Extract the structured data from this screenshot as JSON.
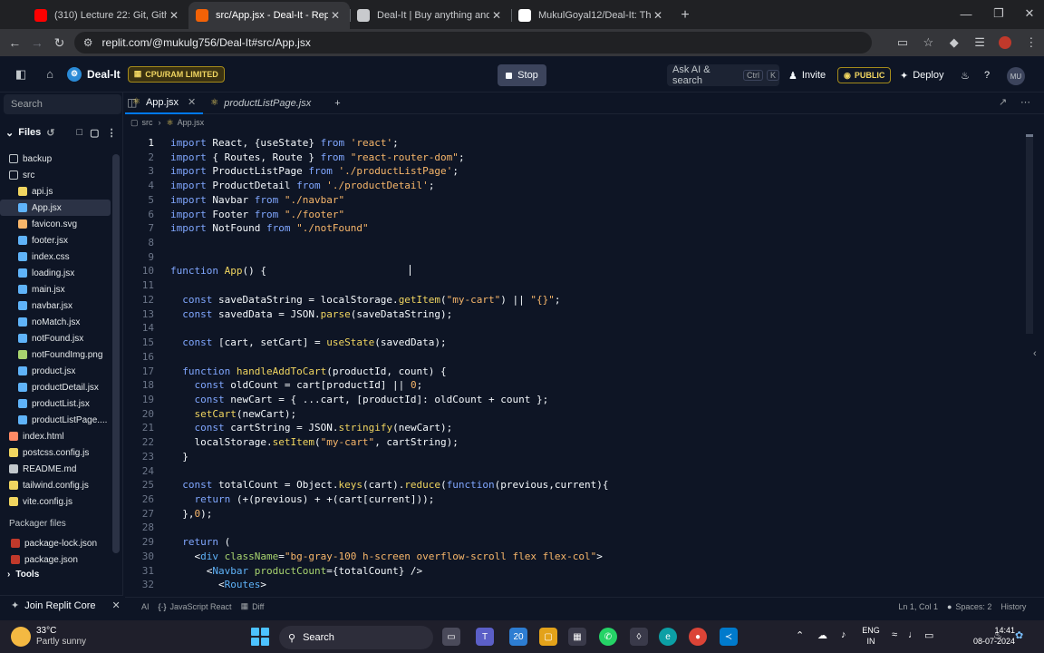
{
  "browser": {
    "tabs": [
      {
        "title": "(310) Lecture 22: Git, Github &",
        "icon": "youtube-icon",
        "color": "#ff0000"
      },
      {
        "title": "src/App.jsx - Deal-It - Replit",
        "icon": "replit-icon",
        "color": "#f26207",
        "active": true
      },
      {
        "title": "Deal-It | Buy anything and get",
        "icon": "globe-icon",
        "color": "#c8cacd"
      },
      {
        "title": "MukulGoyal12/Deal-It: This is a",
        "icon": "github-icon",
        "color": "#ffffff"
      }
    ],
    "url": "replit.com/@mukulg756/Deal-It#src/App.jsx"
  },
  "header": {
    "project": "Deal-It",
    "cpu_badge": "CPU/RAM LIMITED",
    "stop_label": "Stop",
    "ask_ai": "Ask AI & search",
    "ask_kbd_1": "Ctrl",
    "ask_kbd_2": "K",
    "invite": "Invite",
    "public_badge": "PUBLIC",
    "deploy": "Deploy",
    "avatar": "MU"
  },
  "sidebar": {
    "search_placeholder": "Search",
    "files_label": "Files",
    "items": [
      {
        "name": "backup",
        "type": "folder",
        "indent": 0
      },
      {
        "name": "src",
        "type": "folder",
        "indent": 0
      },
      {
        "name": "api.js",
        "type": "js",
        "indent": 1
      },
      {
        "name": "App.jsx",
        "type": "jsx",
        "indent": 1,
        "selected": true
      },
      {
        "name": "favicon.svg",
        "type": "svg",
        "indent": 1
      },
      {
        "name": "footer.jsx",
        "type": "jsx",
        "indent": 1
      },
      {
        "name": "index.css",
        "type": "css",
        "indent": 1
      },
      {
        "name": "loading.jsx",
        "type": "jsx",
        "indent": 1
      },
      {
        "name": "main.jsx",
        "type": "jsx",
        "indent": 1
      },
      {
        "name": "navbar.jsx",
        "type": "jsx",
        "indent": 1
      },
      {
        "name": "noMatch.jsx",
        "type": "jsx",
        "indent": 1
      },
      {
        "name": "notFound.jsx",
        "type": "jsx",
        "indent": 1
      },
      {
        "name": "notFoundImg.png",
        "type": "img",
        "indent": 1
      },
      {
        "name": "product.jsx",
        "type": "jsx",
        "indent": 1
      },
      {
        "name": "productDetail.jsx",
        "type": "jsx",
        "indent": 1
      },
      {
        "name": "productList.jsx",
        "type": "jsx",
        "indent": 1
      },
      {
        "name": "productListPage....",
        "type": "jsx",
        "indent": 1
      },
      {
        "name": "index.html",
        "type": "html",
        "indent": 0
      },
      {
        "name": "postcss.config.js",
        "type": "js",
        "indent": 0
      },
      {
        "name": "README.md",
        "type": "md",
        "indent": 0
      },
      {
        "name": "tailwind.config.js",
        "type": "js",
        "indent": 0
      },
      {
        "name": "vite.config.js",
        "type": "js",
        "indent": 0
      }
    ],
    "packager_label": "Packager files",
    "packager_items": [
      {
        "name": "package-lock.json"
      },
      {
        "name": "package.json"
      }
    ],
    "tools_label": "Tools",
    "join_label": "Join Replit Core"
  },
  "editor": {
    "tabs": [
      {
        "label": "App.jsx",
        "active": true
      },
      {
        "label": "productListPage.jsx",
        "active": false
      }
    ],
    "breadcrumb": [
      "src",
      "App.jsx"
    ],
    "lines": [
      [
        [
          "kw",
          "import"
        ],
        [
          "pl",
          " React, {useState} "
        ],
        [
          "kw",
          "from"
        ],
        [
          "pl",
          " "
        ],
        [
          "st",
          "'react'"
        ],
        [
          "pl",
          ";"
        ]
      ],
      [
        [
          "kw",
          "import"
        ],
        [
          "pl",
          " { Routes, Route } "
        ],
        [
          "kw",
          "from"
        ],
        [
          "pl",
          " "
        ],
        [
          "st",
          "\"react-router-dom\""
        ],
        [
          "pl",
          ";"
        ]
      ],
      [
        [
          "kw",
          "import"
        ],
        [
          "pl",
          " ProductListPage "
        ],
        [
          "kw",
          "from"
        ],
        [
          "pl",
          " "
        ],
        [
          "st",
          "'./productListPage'"
        ],
        [
          "pl",
          ";"
        ]
      ],
      [
        [
          "kw",
          "import"
        ],
        [
          "pl",
          " ProductDetail "
        ],
        [
          "kw",
          "from"
        ],
        [
          "pl",
          " "
        ],
        [
          "st",
          "'./productDetail'"
        ],
        [
          "pl",
          ";"
        ]
      ],
      [
        [
          "kw",
          "import"
        ],
        [
          "pl",
          " Navbar "
        ],
        [
          "kw",
          "from"
        ],
        [
          "pl",
          " "
        ],
        [
          "st",
          "\"./navbar\""
        ]
      ],
      [
        [
          "kw",
          "import"
        ],
        [
          "pl",
          " Footer "
        ],
        [
          "kw",
          "from"
        ],
        [
          "pl",
          " "
        ],
        [
          "st",
          "\"./footer\""
        ]
      ],
      [
        [
          "kw",
          "import"
        ],
        [
          "pl",
          " NotFound "
        ],
        [
          "kw",
          "from"
        ],
        [
          "pl",
          " "
        ],
        [
          "st",
          "\"./notFound\""
        ]
      ],
      [],
      [],
      [
        [
          "kw",
          "function"
        ],
        [
          "pl",
          " "
        ],
        [
          "fn",
          "App"
        ],
        [
          "pl",
          "() {"
        ]
      ],
      [],
      [
        [
          "pl",
          "  "
        ],
        [
          "kw",
          "const"
        ],
        [
          "pl",
          " saveDataString = localStorage."
        ],
        [
          "fn",
          "getItem"
        ],
        [
          "pl",
          "("
        ],
        [
          "st",
          "\"my-cart\""
        ],
        [
          "pl",
          ") || "
        ],
        [
          "st",
          "\"{}\""
        ],
        [
          "pl",
          ";"
        ]
      ],
      [
        [
          "pl",
          "  "
        ],
        [
          "kw",
          "const"
        ],
        [
          "pl",
          " savedData = JSON."
        ],
        [
          "fn",
          "parse"
        ],
        [
          "pl",
          "(saveDataString);"
        ]
      ],
      [],
      [
        [
          "pl",
          "  "
        ],
        [
          "kw",
          "const"
        ],
        [
          "pl",
          " [cart, setCart] = "
        ],
        [
          "fn",
          "useState"
        ],
        [
          "pl",
          "(savedData);"
        ]
      ],
      [],
      [
        [
          "pl",
          "  "
        ],
        [
          "kw",
          "function"
        ],
        [
          "pl",
          " "
        ],
        [
          "fn",
          "handleAddToCart"
        ],
        [
          "pl",
          "(productId, count) {"
        ]
      ],
      [
        [
          "pl",
          "    "
        ],
        [
          "kw",
          "const"
        ],
        [
          "pl",
          " oldCount = cart[productId] || "
        ],
        [
          "st",
          "0"
        ],
        [
          "pl",
          ";"
        ]
      ],
      [
        [
          "pl",
          "    "
        ],
        [
          "kw",
          "const"
        ],
        [
          "pl",
          " newCart = { ...cart, [productId]: oldCount + count };"
        ]
      ],
      [
        [
          "pl",
          "    "
        ],
        [
          "fn",
          "setCart"
        ],
        [
          "pl",
          "(newCart);"
        ]
      ],
      [
        [
          "pl",
          "    "
        ],
        [
          "kw",
          "const"
        ],
        [
          "pl",
          " cartString = JSON."
        ],
        [
          "fn",
          "stringify"
        ],
        [
          "pl",
          "(newCart);"
        ]
      ],
      [
        [
          "pl",
          "    localStorage."
        ],
        [
          "fn",
          "setItem"
        ],
        [
          "pl",
          "("
        ],
        [
          "st",
          "\"my-cart\""
        ],
        [
          "pl",
          ", cartString);"
        ]
      ],
      [
        [
          "pl",
          "  }"
        ]
      ],
      [],
      [
        [
          "pl",
          "  "
        ],
        [
          "kw",
          "const"
        ],
        [
          "pl",
          " totalCount = Object."
        ],
        [
          "fn",
          "keys"
        ],
        [
          "pl",
          "(cart)."
        ],
        [
          "fn",
          "reduce"
        ],
        [
          "pl",
          "("
        ],
        [
          "kw",
          "function"
        ],
        [
          "pl",
          "(previous,current){"
        ]
      ],
      [
        [
          "pl",
          "    "
        ],
        [
          "kw",
          "return"
        ],
        [
          "pl",
          " (+(previous) + +(cart[current]));"
        ]
      ],
      [
        [
          "pl",
          "  },"
        ],
        [
          "st",
          "0"
        ],
        [
          "pl",
          ");"
        ]
      ],
      [],
      [
        [
          "pl",
          "  "
        ],
        [
          "kw",
          "return"
        ],
        [
          "pl",
          " ("
        ]
      ],
      [
        [
          "pl",
          "    <"
        ],
        [
          "tg",
          "div"
        ],
        [
          "pl",
          " "
        ],
        [
          "at",
          "className"
        ],
        [
          "pl",
          "="
        ],
        [
          "st",
          "\"bg-gray-100 h-screen overflow-scroll flex flex-col\""
        ],
        [
          "pl",
          ">"
        ]
      ],
      [
        [
          "pl",
          "      <"
        ],
        [
          "tg",
          "Navbar"
        ],
        [
          "pl",
          " "
        ],
        [
          "at",
          "productCount"
        ],
        [
          "pl",
          "={totalCount} />"
        ]
      ],
      [
        [
          "pl",
          "        <"
        ],
        [
          "tg",
          "Routes"
        ],
        [
          "pl",
          ">"
        ]
      ]
    ]
  },
  "status": {
    "ai": "AI",
    "language": "JavaScript React",
    "diff": "Diff",
    "position": "Ln 1, Col 1",
    "spaces": "Spaces: 2",
    "history": "History"
  },
  "taskbar": {
    "temp": "33°C",
    "weather": "Partly sunny",
    "search": "Search",
    "lang_1": "ENG",
    "lang_2": "IN",
    "time": "14:41",
    "date": "08-07-2024"
  }
}
